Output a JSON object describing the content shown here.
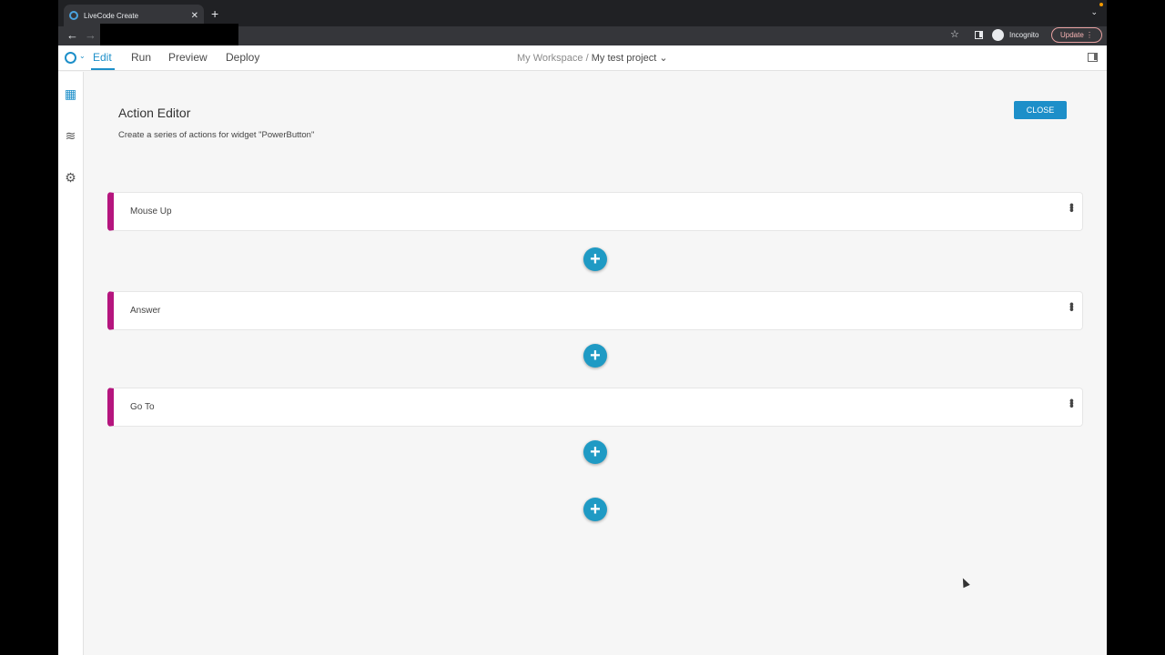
{
  "browser": {
    "tab_title": "LiveCode Create",
    "incognito_label": "Incognito",
    "update_label": "Update"
  },
  "app": {
    "nav": {
      "edit": "Edit",
      "run": "Run",
      "preview": "Preview",
      "deploy": "Deploy"
    },
    "breadcrumb": {
      "workspace": "My Workspace",
      "separator": "/",
      "project": "My test project"
    }
  },
  "editor": {
    "title": "Action Editor",
    "subtitle": "Create a series of actions for widget \"PowerButton\"",
    "close_label": "CLOSE",
    "actions": [
      {
        "label": "Mouse Up"
      },
      {
        "label": "Answer"
      },
      {
        "label": "Go To"
      }
    ]
  },
  "colors": {
    "accent": "#1d8fc9",
    "action_bar": "#b5157e",
    "add_button": "#1f9ac4"
  }
}
